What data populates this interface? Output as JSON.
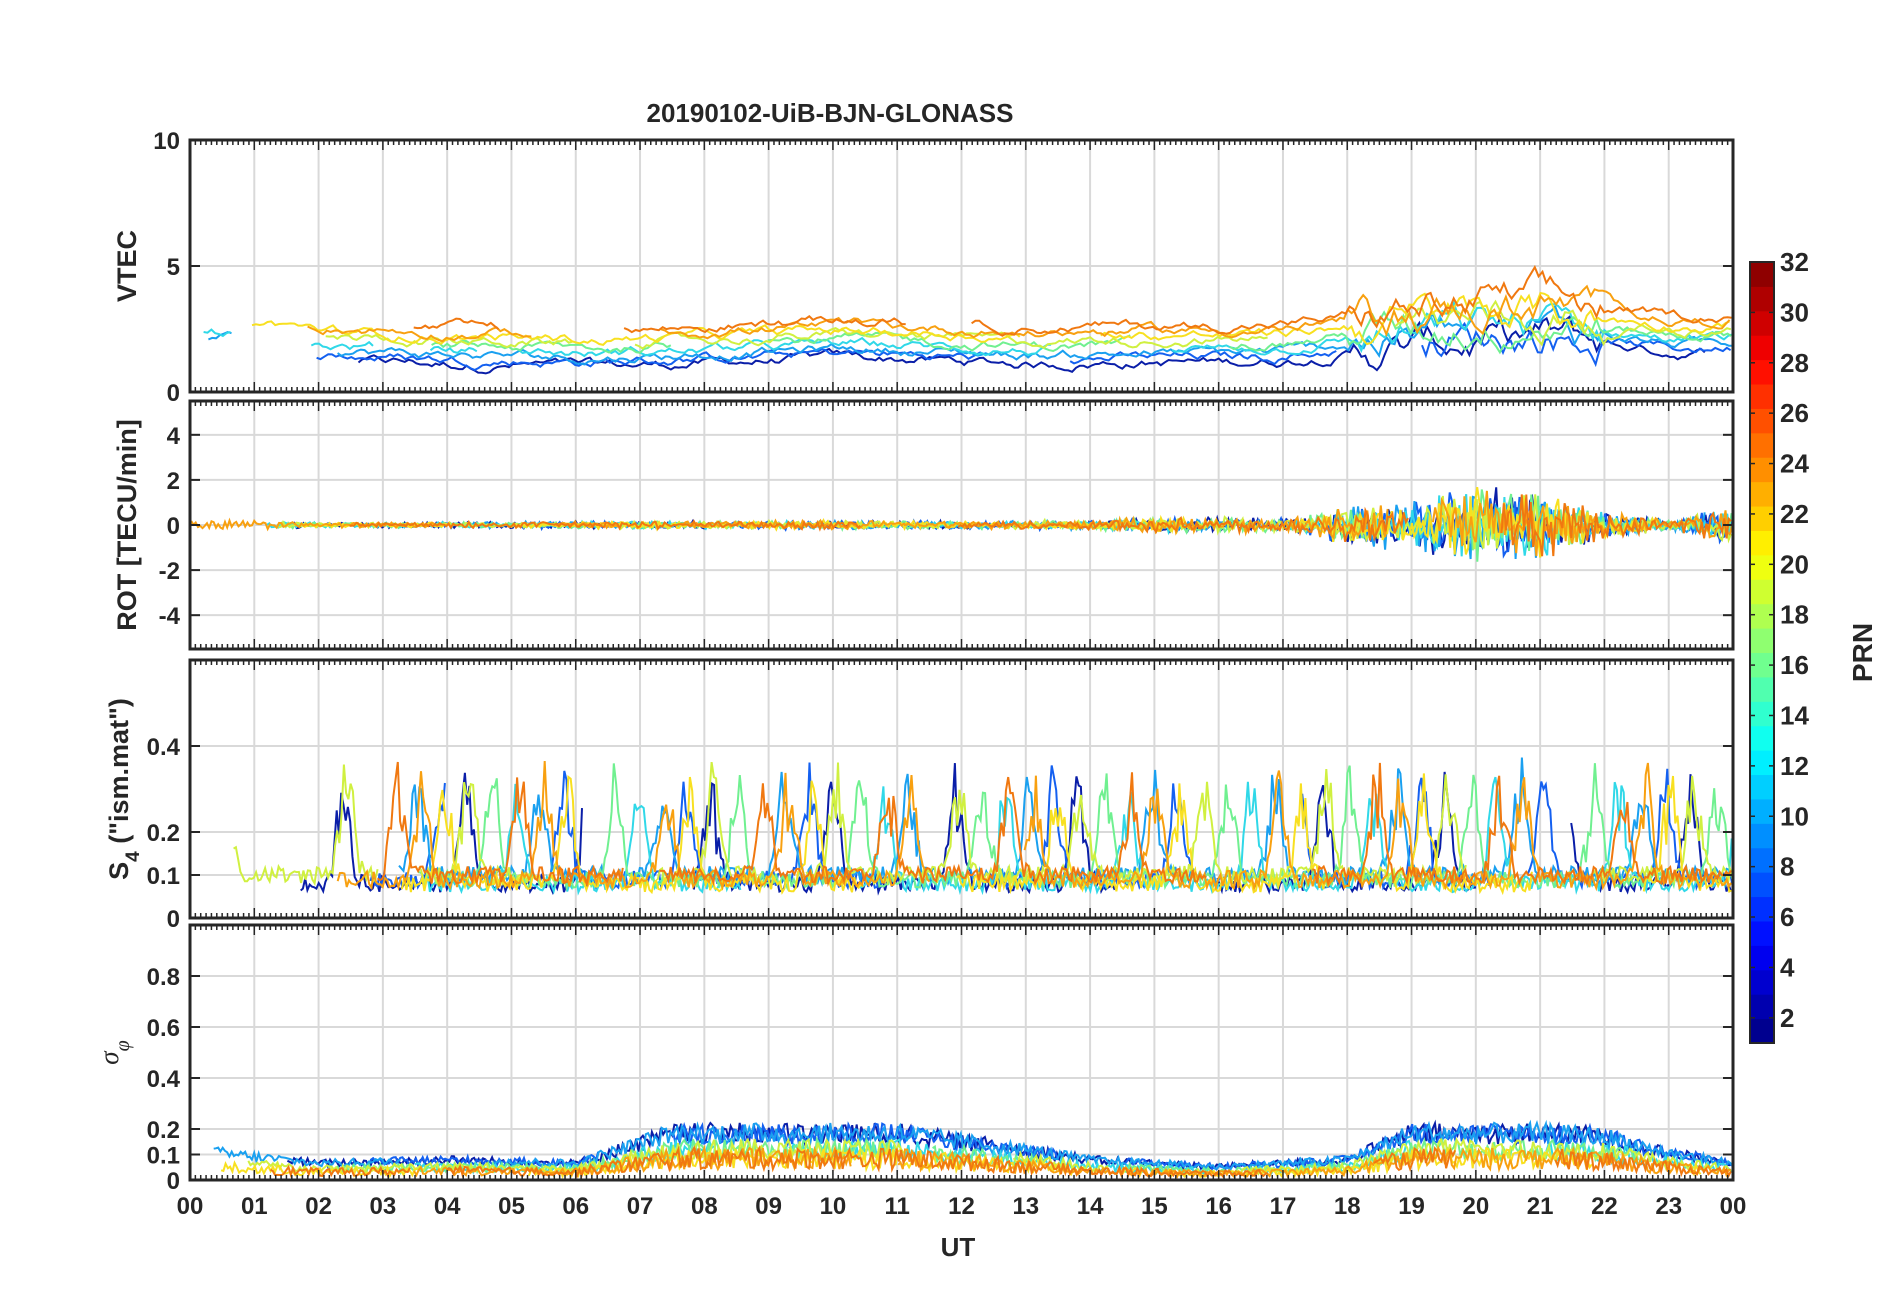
{
  "title": "20190102-UiB-BJN-GLONASS",
  "chart_data": [
    {
      "type": "line",
      "panel": "vtec",
      "ylabel": "VTEC",
      "ylim": [
        0,
        10
      ],
      "yticks": [
        0,
        5,
        10
      ],
      "ytick_labels": [
        "0",
        "5",
        "10"
      ],
      "xlim": [
        0,
        24
      ],
      "grid": true,
      "series_note_colors": [
        "#0a1ea8",
        "#1460f0",
        "#1aa0f0",
        "#30d8e8",
        "#70f090",
        "#d0f040",
        "#f8e020",
        "#f8a010"
      ],
      "approx_baseline": [
        [
          0,
          2.6
        ],
        [
          1,
          2.4
        ],
        [
          2,
          2.0
        ],
        [
          3,
          1.9
        ],
        [
          4,
          1.8
        ],
        [
          5,
          1.8
        ],
        [
          6,
          1.7
        ],
        [
          7,
          1.8
        ],
        [
          8,
          1.9
        ],
        [
          9,
          2.0
        ],
        [
          10,
          2.1
        ],
        [
          11,
          2.0
        ],
        [
          12,
          1.9
        ],
        [
          13,
          1.8
        ],
        [
          14,
          1.9
        ],
        [
          15,
          1.9
        ],
        [
          16,
          1.9
        ],
        [
          17,
          2.0
        ],
        [
          18,
          2.4
        ],
        [
          19,
          2.6
        ],
        [
          20,
          2.8
        ],
        [
          21,
          2.9
        ],
        [
          22,
          2.5
        ],
        [
          23,
          2.2
        ],
        [
          24,
          2.4
        ]
      ]
    },
    {
      "type": "line",
      "panel": "rot",
      "ylabel": "ROT [TECU/min]",
      "ylim": [
        -5.5,
        5.5
      ],
      "yticks": [
        -4,
        -2,
        0,
        2,
        4
      ],
      "ytick_labels": [
        "-4",
        "-2",
        "0",
        "2",
        "4"
      ],
      "xlim": [
        0,
        24
      ],
      "grid": true,
      "approx_amplitude": [
        [
          0,
          0.3
        ],
        [
          2,
          0.1
        ],
        [
          4,
          0.12
        ],
        [
          6,
          0.15
        ],
        [
          8,
          0.15
        ],
        [
          10,
          0.2
        ],
        [
          12,
          0.15
        ],
        [
          14,
          0.2
        ],
        [
          15,
          0.3
        ],
        [
          17,
          0.3
        ],
        [
          18,
          0.8
        ],
        [
          19,
          1.0
        ],
        [
          20,
          1.6
        ],
        [
          21,
          1.3
        ],
        [
          22,
          0.6
        ],
        [
          23,
          0.2
        ],
        [
          24,
          0.8
        ]
      ]
    },
    {
      "type": "line",
      "panel": "s4",
      "ylabel": "S4 (\"ism.mat\")",
      "ylim": [
        0,
        0.6
      ],
      "yticks": [
        0,
        0.1,
        0.2,
        0.4
      ],
      "ytick_labels": [
        "0",
        "0.1",
        "0.2",
        "0.4"
      ],
      "xlim": [
        0,
        24
      ],
      "grid": true,
      "approx_baseline": 0.06,
      "approx_peaks": [
        0.27,
        0.29,
        0.25,
        0.23,
        0.26,
        0.32,
        0.33,
        0.37,
        0.36,
        0.31,
        0.27,
        0.34,
        0.37,
        0.29,
        0.32,
        0.33,
        0.34,
        0.34
      ]
    },
    {
      "type": "line",
      "panel": "sigma_phi",
      "ylabel": "σφ",
      "ylim": [
        0,
        1
      ],
      "yticks": [
        0,
        0.1,
        0.2,
        0.4,
        0.6,
        0.8
      ],
      "ytick_labels": [
        "0",
        "0.1",
        "0.2",
        "0.4",
        "0.6",
        "0.8"
      ],
      "xlim": [
        0,
        24
      ],
      "grid": true,
      "approx_level": [
        [
          0,
          0.09
        ],
        [
          2,
          0.05
        ],
        [
          4,
          0.06
        ],
        [
          6,
          0.05
        ],
        [
          7.5,
          0.14
        ],
        [
          9,
          0.14
        ],
        [
          10,
          0.14
        ],
        [
          11,
          0.14
        ],
        [
          13,
          0.09
        ],
        [
          14,
          0.06
        ],
        [
          16,
          0.04
        ],
        [
          18,
          0.06
        ],
        [
          19,
          0.14
        ],
        [
          21,
          0.14
        ],
        [
          22,
          0.13
        ],
        [
          23,
          0.08
        ],
        [
          24,
          0.05
        ]
      ]
    }
  ],
  "xaxis": {
    "label": "UT",
    "tick_labels": [
      "00",
      "01",
      "02",
      "03",
      "04",
      "05",
      "06",
      "07",
      "08",
      "09",
      "10",
      "11",
      "12",
      "13",
      "14",
      "15",
      "16",
      "17",
      "18",
      "19",
      "20",
      "21",
      "22",
      "23",
      "00"
    ]
  },
  "colorbar": {
    "label": "PRN",
    "range": [
      1,
      32
    ],
    "tick_values": [
      2,
      4,
      6,
      8,
      10,
      12,
      14,
      16,
      18,
      20,
      22,
      24,
      26,
      28,
      30,
      32
    ],
    "tick_labels": [
      "2",
      "4",
      "6",
      "8",
      "10",
      "12",
      "14",
      "16",
      "18",
      "20",
      "22",
      "24",
      "26",
      "28",
      "30",
      "32"
    ],
    "colormap": "jet"
  }
}
